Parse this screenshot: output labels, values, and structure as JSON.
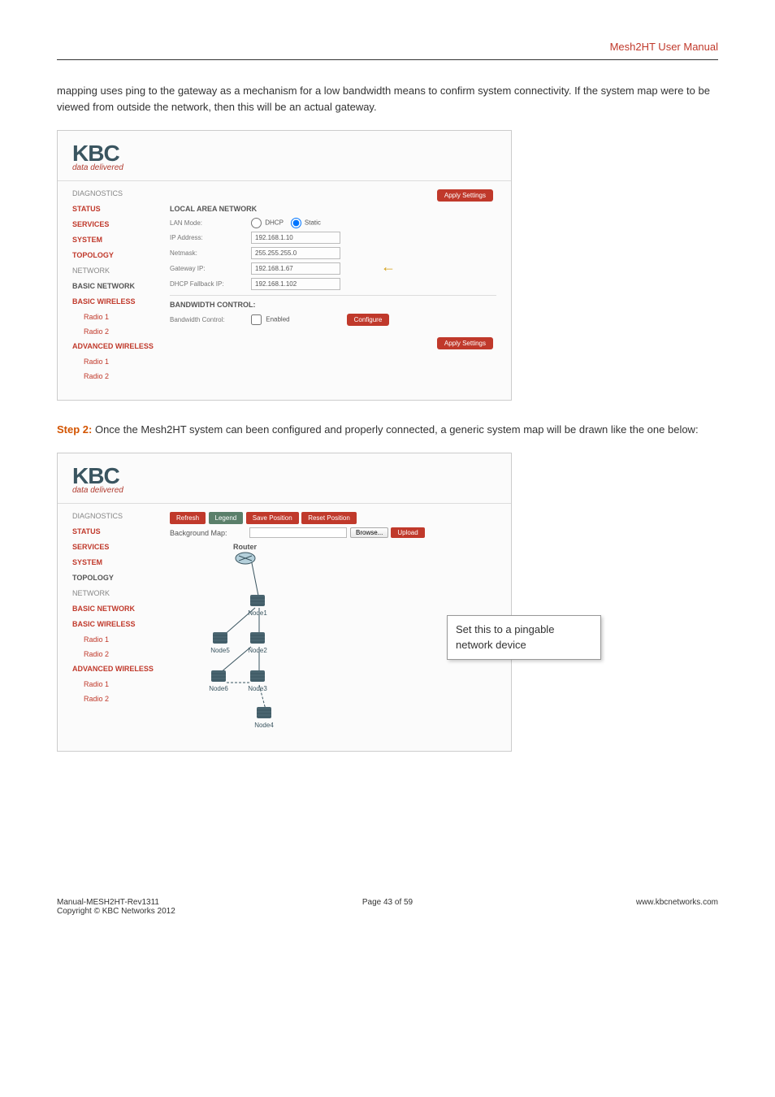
{
  "header": {
    "title": "Mesh2HT User Manual"
  },
  "intro_text": "mapping uses ping to the gateway as a mechanism for a low bandwidth means to confirm system connectivity. If the system map were to be viewed from outside the network, then this will be an actual gateway.",
  "logo": {
    "brand": "KBC",
    "tagline": "data delivered"
  },
  "screenshot1": {
    "sidebar": {
      "diagnostics": "DIAGNOSTICS",
      "status": "STATUS",
      "services": "SERVICES",
      "system": "SYSTEM",
      "topology": "TOPOLOGY",
      "network": "NETWORK",
      "basic_network": "BASIC NETWORK",
      "basic_wireless": "BASIC WIRELESS",
      "radio1": "Radio 1",
      "radio2": "Radio 2",
      "advanced_wireless": "ADVANCED WIRELESS",
      "adv_radio1": "Radio 1",
      "adv_radio2": "Radio 2"
    },
    "apply_top": "Apply Settings",
    "section_lan": "LOCAL AREA NETWORK",
    "fields": {
      "lan_mode_label": "LAN Mode:",
      "lan_mode_dhcp": "DHCP",
      "lan_mode_static": "Static",
      "ip_address_label": "IP Address:",
      "ip_address_val": "192.168.1.10",
      "netmask_label": "Netmask:",
      "netmask_val": "255.255.255.0",
      "gateway_label": "Gateway IP:",
      "gateway_val": "192.168.1.67",
      "fallback_label": "DHCP Fallback IP:",
      "fallback_val": "192.168.1.102"
    },
    "section_bw": "BANDWIDTH CONTROL:",
    "bw_label": "Bandwidth Control:",
    "bw_enabled": "Enabled",
    "configure": "Configure",
    "apply_bottom": "Apply Settings"
  },
  "step2": {
    "label": "Step 2:",
    "text": " Once the Mesh2HT system can been configured and properly connected, a generic system map will be drawn like the one below:"
  },
  "screenshot2": {
    "sidebar": {
      "diagnostics": "DIAGNOSTICS",
      "status": "STATUS",
      "services": "SERVICES",
      "system": "SYSTEM",
      "topology": "TOPOLOGY",
      "network": "NETWORK",
      "basic_network": "BASIC NETWORK",
      "basic_wireless": "BASIC WIRELESS",
      "radio1": "Radio 1",
      "radio2": "Radio 2",
      "advanced_wireless": "ADVANCED WIRELESS",
      "adv_radio1": "Radio 1",
      "adv_radio2": "Radio 2"
    },
    "topbar": {
      "refresh": "Refresh",
      "legend": "Legend",
      "save_pos": "Save Position",
      "reset_pos": "Reset Position"
    },
    "bgmap_label": "Background Map:",
    "browse": "Browse...",
    "upload": "Upload",
    "nodes": {
      "router": "Router",
      "n1": "Node1",
      "n2": "Node2",
      "n3": "Node3",
      "n4": "Node4",
      "n5": "Node5",
      "n6": "Node6"
    }
  },
  "callout": "Set this to a pingable network device",
  "footer": {
    "line1": "Manual-MESH2HT-Rev1311",
    "line2": "Copyright © KBC Networks 2012",
    "page": "Page 43 of 59",
    "url": "www.kbcnetworks.com"
  }
}
